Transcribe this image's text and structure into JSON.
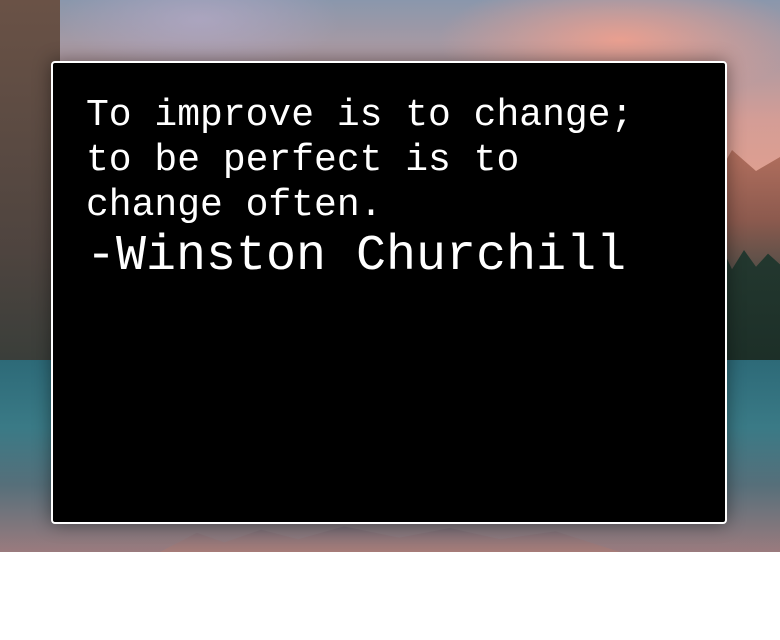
{
  "quote": {
    "text": "To improve is to change;\nto be perfect is to\nchange often.",
    "author": "-Winston Churchill"
  },
  "colors": {
    "card_background": "#000000",
    "card_border": "#ffffff",
    "text": "#ffffff",
    "page_background": "#ffffff"
  }
}
